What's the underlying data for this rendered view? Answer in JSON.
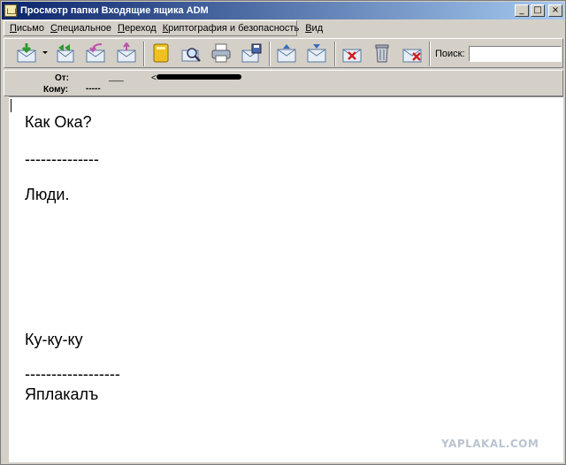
{
  "window": {
    "title": "Просмотр папки Входящие ящика ADM",
    "btn_minimize": "_",
    "btn_maximize": "□",
    "btn_close": "×"
  },
  "menu": {
    "items": [
      {
        "first": "П",
        "rest": "исьмо"
      },
      {
        "first": "С",
        "rest": "пециальное"
      },
      {
        "first": "П",
        "rest": "ереход"
      },
      {
        "first": "К",
        "rest": "риптография и безопасность"
      },
      {
        "first": "В",
        "rest": "ид"
      }
    ]
  },
  "toolbar": {
    "search_label": "Поиск:",
    "search_value": ""
  },
  "headers": {
    "from_label": "От:",
    "from_value": "___",
    "from_extra": "<",
    "to_label": "Кому:",
    "to_value": "-----"
  },
  "message": {
    "lines": [
      "Как Ока?",
      "--------------",
      "Люди.",
      "Ку-ку-ку",
      "------------------",
      "Яплакалъ"
    ]
  },
  "watermark": "YAPLAKAL.COM",
  "colors": {
    "titlebar_start": "#0a246a",
    "titlebar_end": "#a6caf0",
    "chrome": "#d4d0c8",
    "watermark": "#b9c4d0"
  }
}
